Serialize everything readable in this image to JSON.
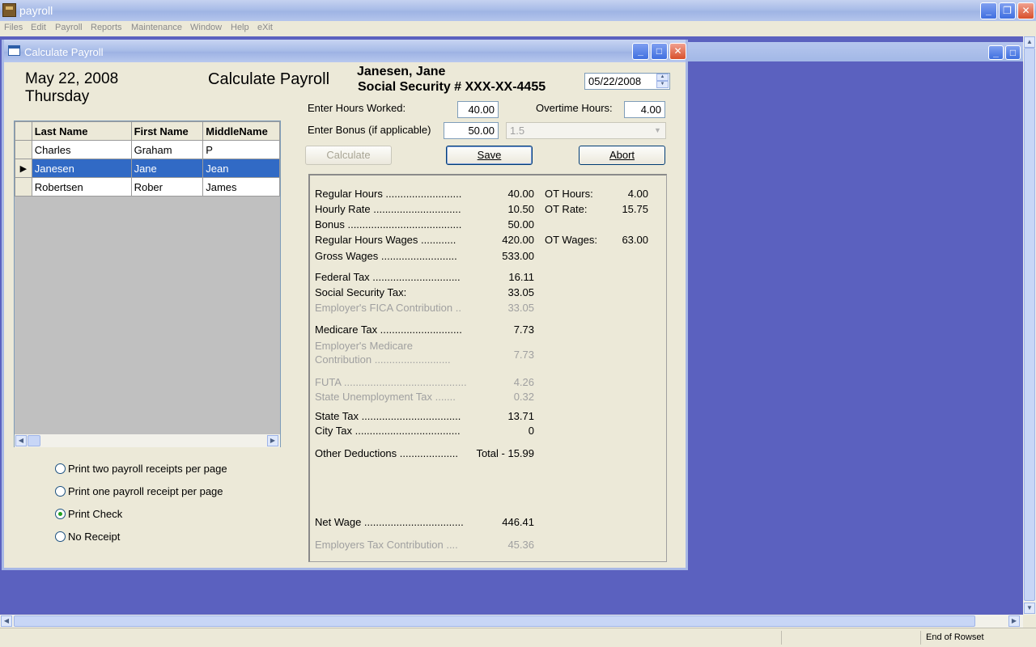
{
  "app": {
    "title": "payroll",
    "menu": [
      "Files",
      "Edit",
      "Payroll",
      "Reports",
      "Maintenance",
      "Window",
      "Help",
      "eXit"
    ]
  },
  "child": {
    "title": "Calculate Payroll",
    "date_long": "May 22, 2008",
    "weekday": "Thursday",
    "heading": "Calculate Payroll",
    "employee_name": "Janesen, Jane",
    "ssn": "Social Security # XXX-XX-4455",
    "date_field": "05/22/2008",
    "hours_label": "Enter Hours Worked:",
    "hours_value": "40.00",
    "ot_hours_label": "Overtime Hours:",
    "ot_hours_value": "4.00",
    "bonus_label": "Enter Bonus (if applicable)",
    "bonus_value": "50.00",
    "ot_multiplier": "1.5",
    "buttons": {
      "calculate": "Calculate",
      "save": "Save",
      "abort": "Abort"
    }
  },
  "grid": {
    "columns": [
      "Last Name",
      "First Name",
      "MiddleName"
    ],
    "rows": [
      [
        "Charles",
        "Graham",
        "P"
      ],
      [
        "Janesen",
        "Jane",
        "Jean"
      ],
      [
        "Robertsen",
        "Rober",
        "James"
      ]
    ],
    "selected_row": 1
  },
  "receipt_options": {
    "items": [
      "Print two payroll receipts per page",
      "Print one payroll receipt per page",
      "Print Check",
      "No Receipt"
    ],
    "selected": 2
  },
  "results": {
    "regular_hours": {
      "label": "Regular Hours ..........................",
      "value": "40.00"
    },
    "hourly_rate": {
      "label": "Hourly Rate ..............................",
      "value": "10.50"
    },
    "bonus": {
      "label": "Bonus .......................................",
      "value": "50.00"
    },
    "regular_wages": {
      "label": "Regular Hours Wages ............",
      "value": "420.00"
    },
    "gross_wages": {
      "label": "Gross Wages ..........................",
      "value": "533.00"
    },
    "federal_tax": {
      "label": "Federal Tax ..............................",
      "value": "16.11"
    },
    "ss_tax": {
      "label": "Social Security Tax:",
      "value": "33.05"
    },
    "fica": {
      "label": "Employer's FICA Contribution ..",
      "value": "33.05"
    },
    "medicare": {
      "label": "Medicare Tax ............................",
      "value": "7.73"
    },
    "emp_medicare_1": {
      "label": "Employer's Medicare"
    },
    "emp_medicare_2": {
      "label": "Contribution ..........................",
      "value": "7.73"
    },
    "futa": {
      "label": "FUTA ..........................................",
      "value": "4.26"
    },
    "sut": {
      "label": "State Unemployment Tax .......",
      "value": "0.32"
    },
    "state_tax": {
      "label": "State Tax ..................................",
      "value": "13.71"
    },
    "city_tax": {
      "label": "City Tax ....................................",
      "value": "0"
    },
    "other_ded": {
      "label": "Other Deductions ....................",
      "value": "Total - 15.99"
    },
    "net_wage": {
      "label": "Net Wage ..................................",
      "value": "446.41"
    },
    "emp_tax": {
      "label": "Employers Tax Contribution ....",
      "value": "45.36"
    },
    "ot_hours": {
      "label": "OT Hours:",
      "value": "4.00"
    },
    "ot_rate": {
      "label": "OT Rate:",
      "value": "15.75"
    },
    "ot_wages": {
      "label": "OT Wages:",
      "value": "63.00"
    }
  },
  "status": {
    "text": "End of Rowset"
  }
}
